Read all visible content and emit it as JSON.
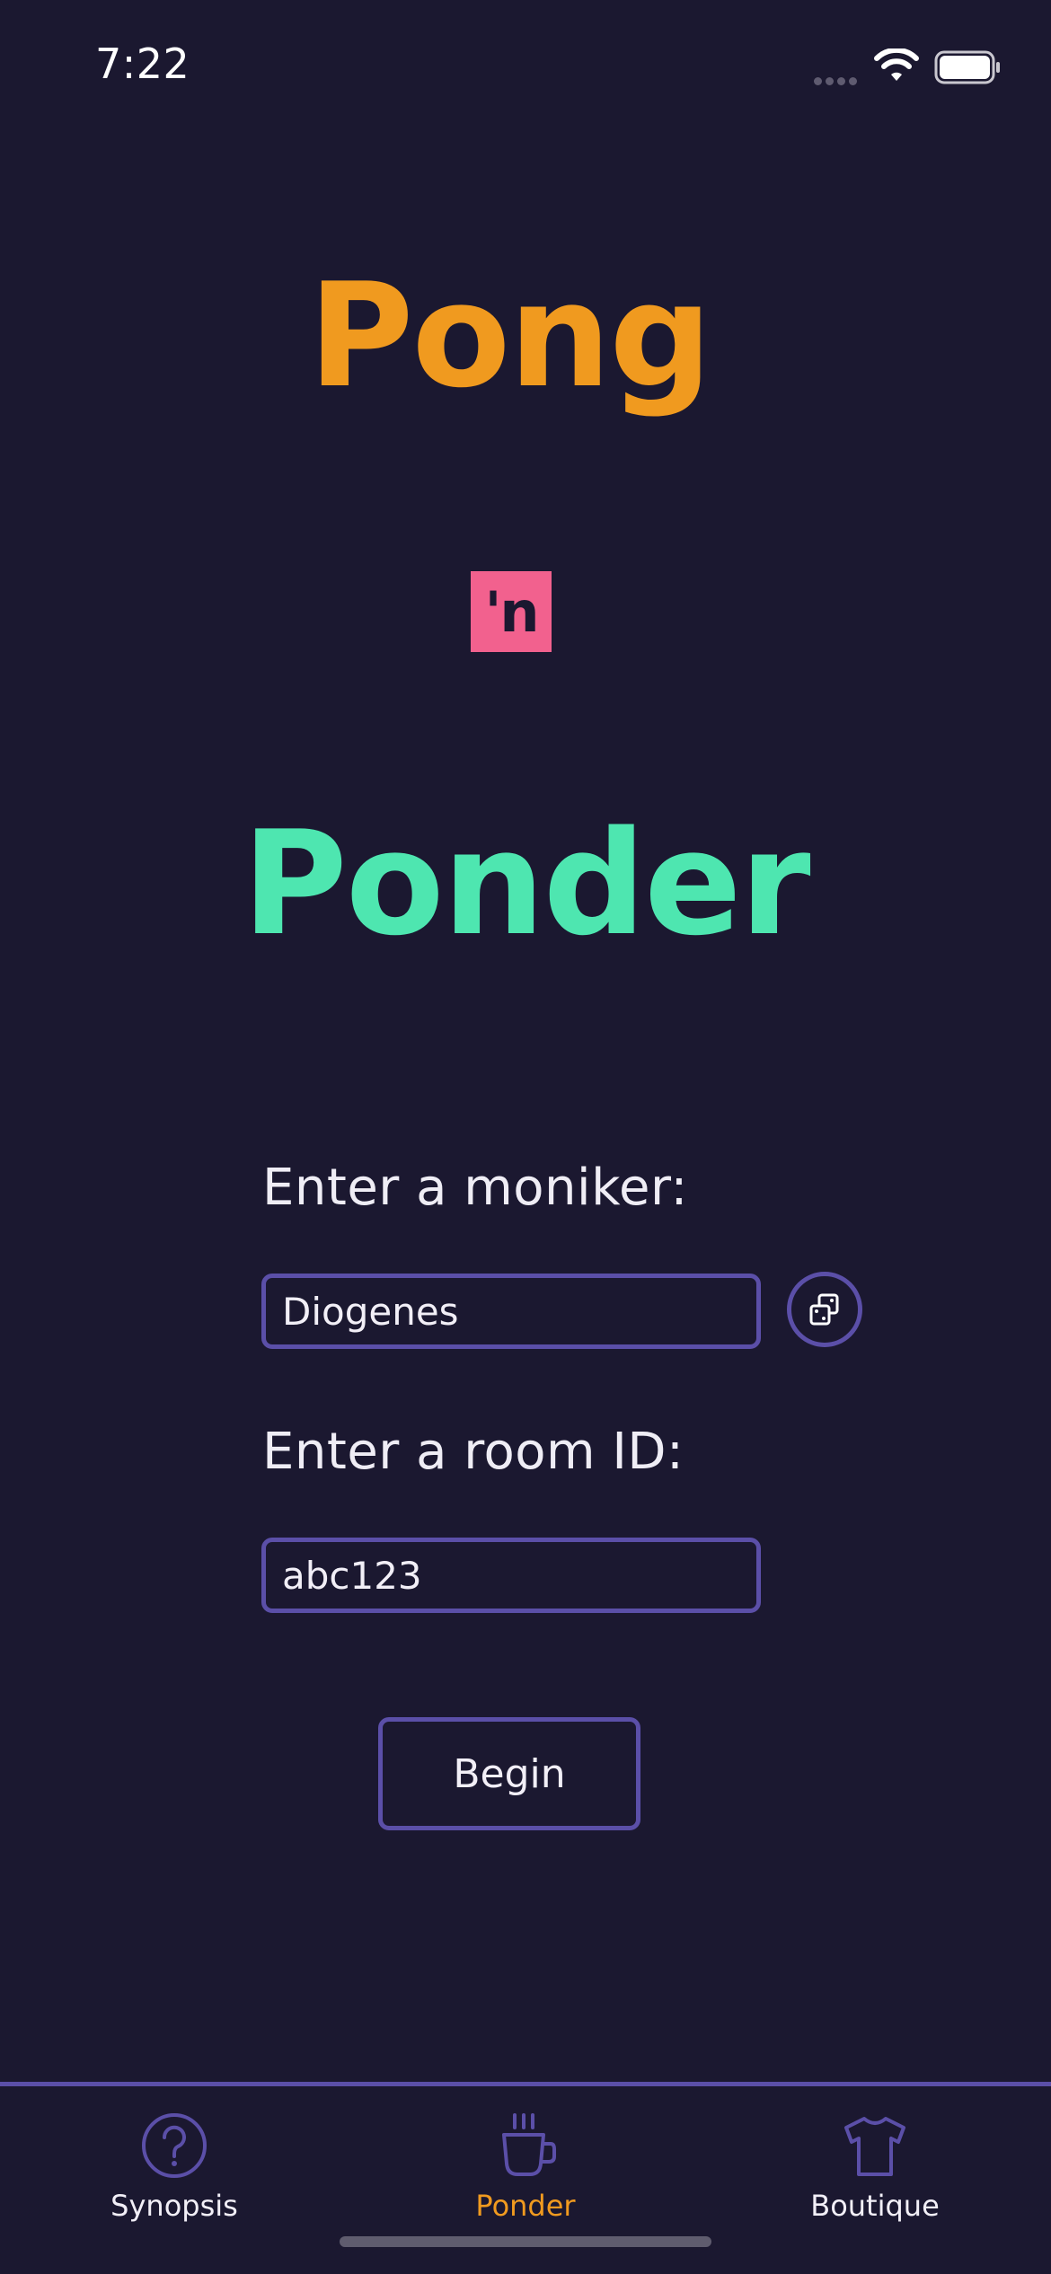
{
  "status_bar": {
    "time": "7:22"
  },
  "title": {
    "pong": "Pong",
    "connector": "'n",
    "ponder": "Ponder"
  },
  "form": {
    "moniker_label": "Enter a moniker:",
    "moniker_value": "Diogenes",
    "room_label": "Enter a room ID:",
    "room_value": "abc123",
    "begin_label": "Begin"
  },
  "tabs": [
    {
      "label": "Synopsis",
      "icon": "question-circle-icon",
      "active": false
    },
    {
      "label": "Ponder",
      "icon": "coffee-cup-icon",
      "active": true
    },
    {
      "label": "Boutique",
      "icon": "tshirt-icon",
      "active": false
    }
  ],
  "colors": {
    "background": "#1b1830",
    "accent_orange": "#f09a1f",
    "accent_green": "#4ee6b0",
    "accent_pink": "#f2618e",
    "border_purple": "#5b4fa8"
  }
}
